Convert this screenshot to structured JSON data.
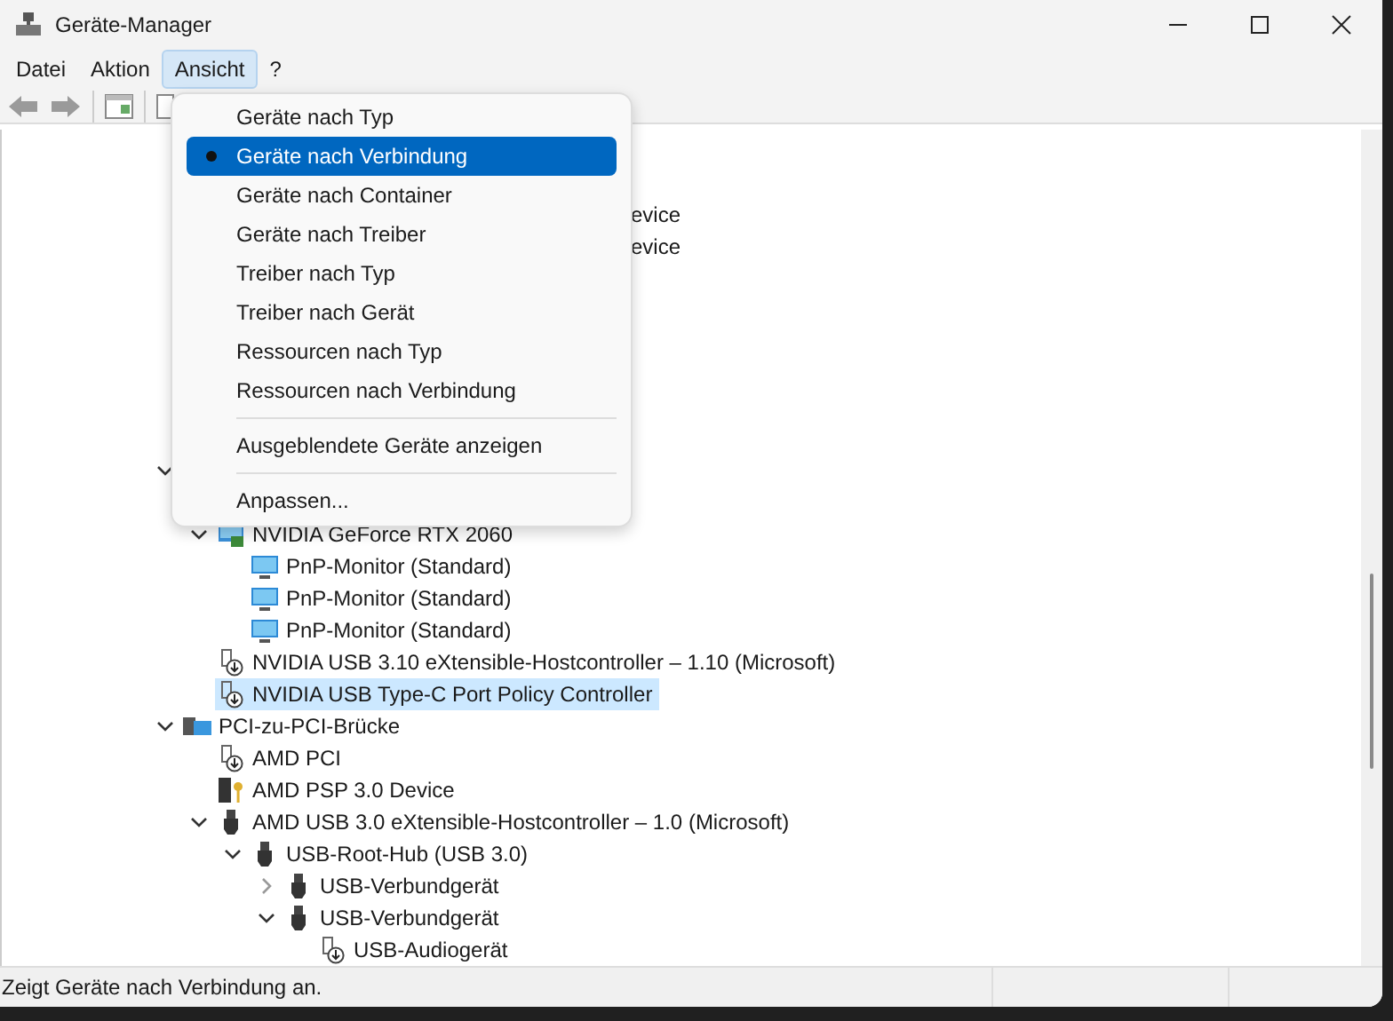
{
  "window": {
    "title": "Geräte-Manager"
  },
  "menu_bar": [
    {
      "label": "Datei",
      "selected": false
    },
    {
      "label": "Aktion",
      "selected": false
    },
    {
      "label": "Ansicht",
      "selected": true
    },
    {
      "label": "?",
      "selected": false
    }
  ],
  "view_menu": {
    "items": [
      {
        "kind": "item",
        "label": "Geräte nach Typ",
        "selected": false
      },
      {
        "kind": "item",
        "label": "Geräte nach Verbindung",
        "selected": true
      },
      {
        "kind": "item",
        "label": "Geräte nach Container",
        "selected": false
      },
      {
        "kind": "item",
        "label": "Geräte nach Treiber",
        "selected": false
      },
      {
        "kind": "item",
        "label": "Treiber nach Typ",
        "selected": false
      },
      {
        "kind": "item",
        "label": "Treiber nach Gerät",
        "selected": false
      },
      {
        "kind": "item",
        "label": "Ressourcen nach Typ",
        "selected": false
      },
      {
        "kind": "item",
        "label": "Ressourcen nach Verbindung",
        "selected": false
      },
      {
        "kind": "separator"
      },
      {
        "kind": "item",
        "label": "Ausgeblendete Geräte anzeigen",
        "selected": false
      },
      {
        "kind": "separator"
      },
      {
        "kind": "item",
        "label": "Anpassen...",
        "selected": false
      }
    ]
  },
  "tree": {
    "cut_rows": [
      "evice",
      "evice"
    ],
    "nodes": [
      {
        "kind": "hidden",
        "expanded": true,
        "children": [
          {
            "kind": "gpu",
            "label": "NVIDIA GeForce RTX 2060",
            "expanded": true,
            "selected": false,
            "children": [
              {
                "kind": "monitor",
                "label": "PnP-Monitor (Standard)",
                "selected": false
              },
              {
                "kind": "monitor",
                "label": "PnP-Monitor (Standard)",
                "selected": false
              },
              {
                "kind": "monitor",
                "label": "PnP-Monitor (Standard)",
                "selected": false
              }
            ]
          },
          {
            "kind": "controller",
            "label": "NVIDIA USB 3.10 eXtensible-Hostcontroller – 1.10 (Microsoft)",
            "selected": false
          },
          {
            "kind": "controller",
            "label": "NVIDIA USB Type-C Port Policy Controller",
            "selected": true
          }
        ]
      },
      {
        "kind": "bridge",
        "label": "PCI-zu-PCI-Brücke",
        "expanded": true,
        "selected": false,
        "children": [
          {
            "kind": "controller",
            "label": "AMD PCI",
            "selected": false
          },
          {
            "kind": "security",
            "label": "AMD PSP 3.0 Device",
            "selected": false
          },
          {
            "kind": "usb",
            "label": "AMD USB 3.0 eXtensible-Hostcontroller – 1.0 (Microsoft)",
            "expanded": true,
            "selected": false,
            "children": [
              {
                "kind": "usb",
                "label": "USB-Root-Hub (USB 3.0)",
                "expanded": true,
                "selected": false,
                "children": [
                  {
                    "kind": "usb",
                    "label": "USB-Verbundgerät",
                    "expanded": false,
                    "selected": false
                  },
                  {
                    "kind": "usb",
                    "label": "USB-Verbundgerät",
                    "expanded": true,
                    "selected": false,
                    "children": [
                      {
                        "kind": "controller",
                        "label": "USB-Audiogerät",
                        "selected": false
                      }
                    ]
                  }
                ]
              }
            ]
          }
        ]
      }
    ]
  },
  "status_bar": {
    "text": "Zeigt Geräte nach Verbindung an."
  }
}
